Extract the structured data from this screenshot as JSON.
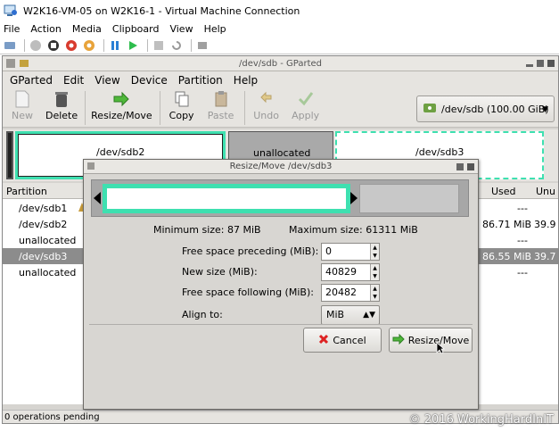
{
  "vm_window": {
    "title": "W2K16-VM-05 on W2K16-1 - Virtual Machine Connection",
    "menu": [
      "File",
      "Action",
      "Media",
      "Clipboard",
      "View",
      "Help"
    ]
  },
  "gparted": {
    "window_title": "/dev/sdb - GParted",
    "menu": [
      "GParted",
      "Edit",
      "View",
      "Device",
      "Partition",
      "Help"
    ],
    "toolbar": {
      "new": "New",
      "delete": "Delete",
      "resize_move": "Resize/Move",
      "copy": "Copy",
      "paste": "Paste",
      "undo": "Undo",
      "apply": "Apply"
    },
    "device_selector": "/dev/sdb  (100.00 GiB)",
    "disk_graph": {
      "sdb2": "/dev/sdb2",
      "unallocated": "unallocated",
      "sdb3": "/dev/sdb3"
    },
    "table": {
      "headers": {
        "partition": "Partition",
        "used": "Used",
        "unused": "Unu"
      },
      "rows": [
        {
          "partition": "/dev/sdb1",
          "used": "---",
          "unused": ""
        },
        {
          "partition": "/dev/sdb2",
          "used": "86.71 MiB",
          "unused": "39.9"
        },
        {
          "partition": "unallocated",
          "used": "---",
          "unused": ""
        },
        {
          "partition": "/dev/sdb3",
          "used": "86.55 MiB",
          "unused": "39.7"
        },
        {
          "partition": "unallocated",
          "used": "---",
          "unused": ""
        }
      ]
    },
    "status": "0 operations pending"
  },
  "dialog": {
    "title": "Resize/Move /dev/sdb3",
    "min_size": "Minimum size: 87 MiB",
    "max_size": "Maximum size: 61311 MiB",
    "fields": {
      "free_preceding_label": "Free space preceding (MiB):",
      "free_preceding_value": "0",
      "new_size_label": "New size (MiB):",
      "new_size_value": "40829",
      "free_following_label": "Free space following (MiB):",
      "free_following_value": "20482",
      "align_label": "Align to:",
      "align_value": "MiB"
    },
    "cancel": "Cancel",
    "resize_move": "Resize/Move"
  },
  "watermark": "© 2016 WorkingHardInIT",
  "colors": {
    "partition_accent": "#3ee0b0",
    "selected_row": "#8c8c8c"
  }
}
